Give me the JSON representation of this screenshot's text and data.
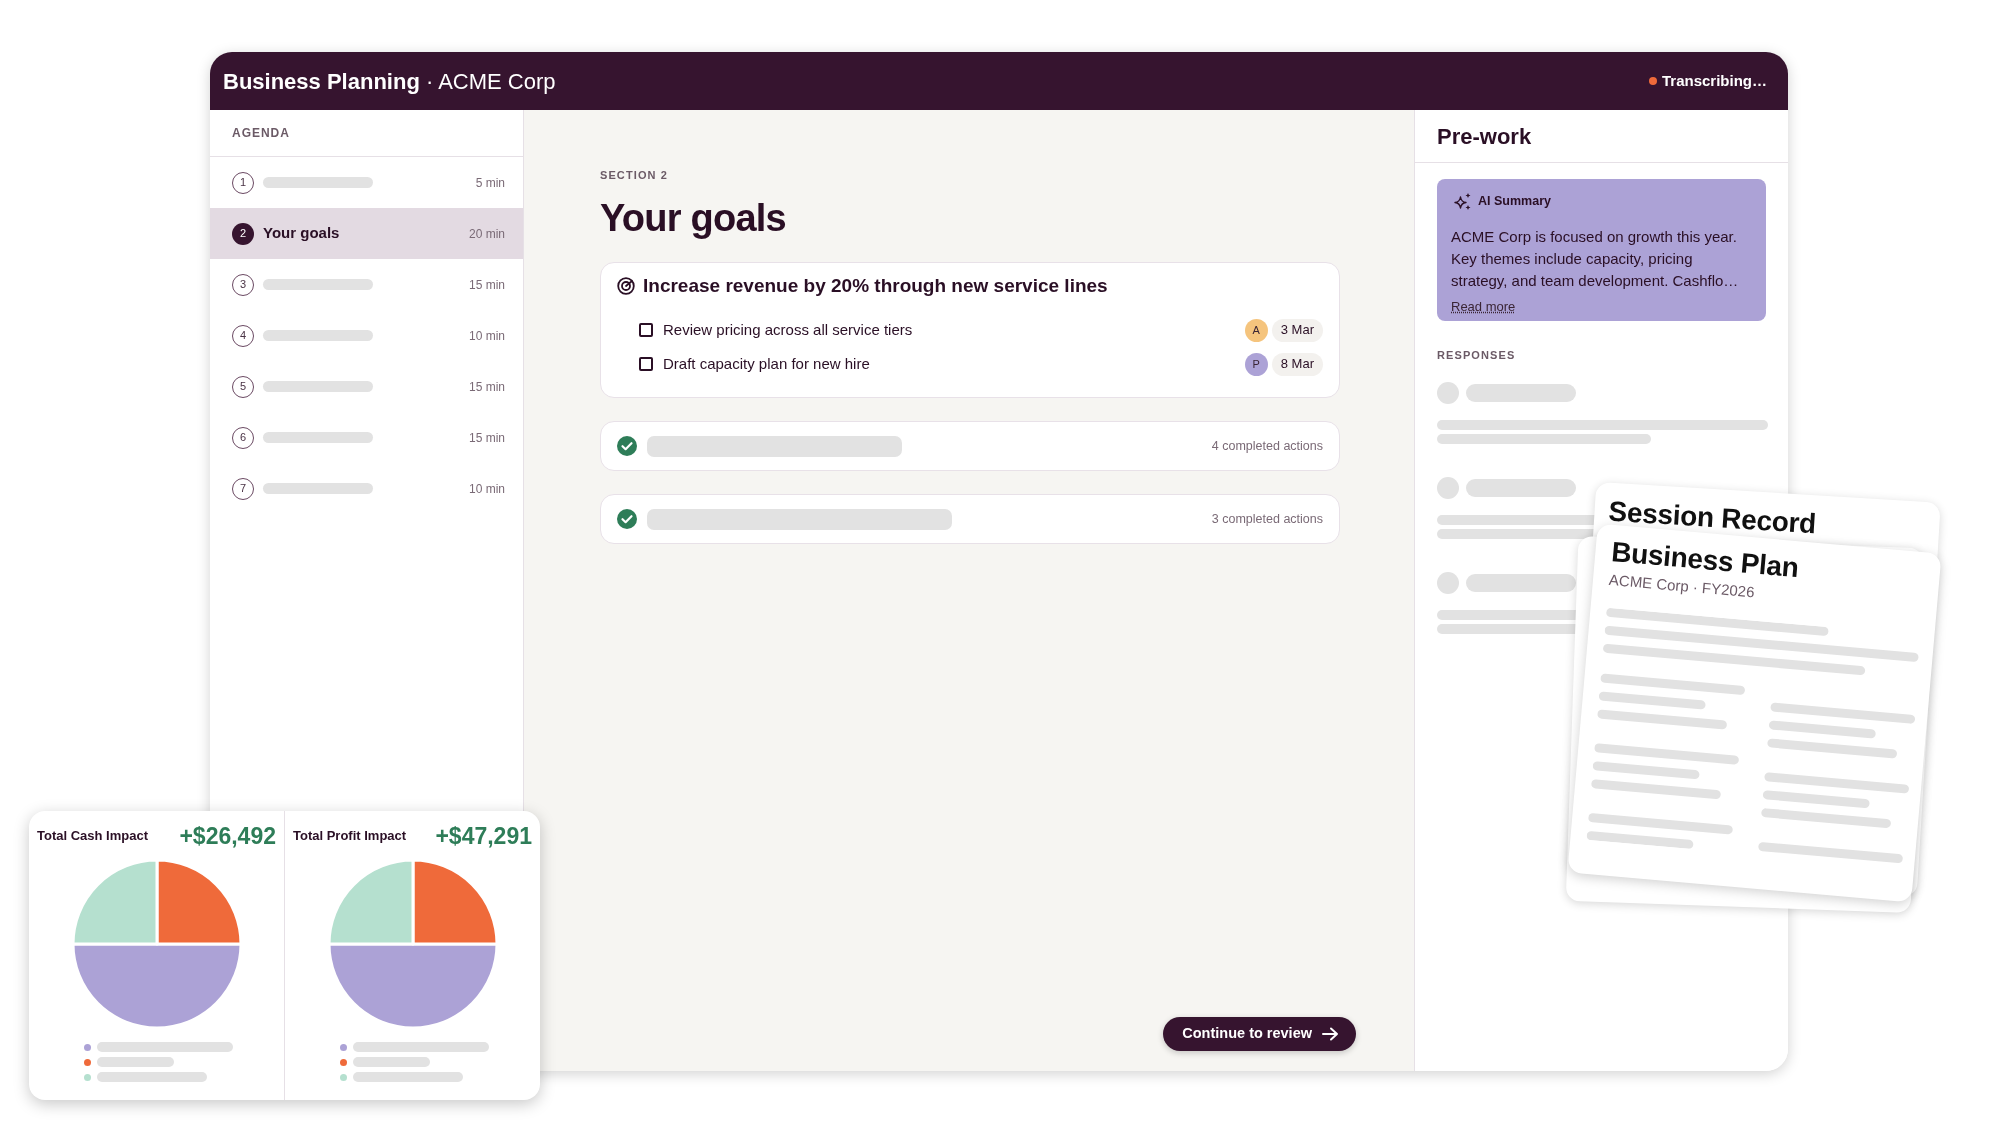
{
  "window": {
    "title": "**Business Planning** · ACME Corp",
    "status": {
      "label": "Transcribing…",
      "live": true
    }
  },
  "agenda": {
    "heading": "AGENDA",
    "items": [
      {
        "number": "1",
        "duration": "5 min",
        "selected": false
      },
      {
        "number": "2",
        "title": "Your goals",
        "duration": "20 min",
        "selected": true
      },
      {
        "number": "3",
        "duration": "15 min",
        "selected": false
      },
      {
        "number": "4",
        "duration": "10 min",
        "selected": false
      },
      {
        "number": "5",
        "duration": "15 min",
        "selected": false
      },
      {
        "number": "6",
        "duration": "15 min",
        "selected": false
      },
      {
        "number": "7",
        "duration": "10 min",
        "selected": false
      }
    ]
  },
  "section": {
    "eyebrow": "SECTION 2",
    "title": "Your goals",
    "goals": [
      {
        "expanded": true,
        "completed": false,
        "title": "Increase revenue by 20% through new service lines",
        "actions": [
          {
            "label": "Review pricing across all service tiers",
            "checked": false,
            "assignee": {
              "initial": "A",
              "color": "#f5c47d"
            },
            "due": "3 Mar"
          },
          {
            "label": "Draft capacity plan for new hire",
            "checked": false,
            "assignee": {
              "initial": "P",
              "color": "#aca2d6"
            },
            "due": "8 Mar"
          }
        ]
      },
      {
        "expanded": false,
        "completed": true,
        "summary": "4 completed actions"
      },
      {
        "expanded": false,
        "completed": true,
        "summary": "3 completed actions"
      }
    ],
    "continue_button": "Continue to review"
  },
  "prework": {
    "title": "Pre-work",
    "ai_summary": {
      "label": "AI Summary",
      "text": "ACME Corp is focused on growth this year. Key themes include capacity, pricing strategy, and team development. Cashflo…",
      "link": "Read more"
    },
    "responses_heading": "RESPONSES"
  },
  "documents": [
    {
      "title": "Session Record"
    },
    {
      "title": "Business Plan",
      "subtitle": "ACME Corp · FY2026"
    }
  ],
  "impact_charts": [
    {
      "title": "Total Cash Impact",
      "value": "+$26,492",
      "chart_data": {
        "type": "pie",
        "values": [
          50,
          25,
          25
        ]
      },
      "legend": [
        {
          "color": "#aca2d6"
        },
        {
          "color": "#ef6a3a"
        },
        {
          "color": "#b5e0cf"
        }
      ]
    },
    {
      "title": "Total Profit Impact",
      "value": "+$47,291",
      "chart_data": {
        "type": "pie",
        "values": [
          50,
          25,
          25
        ]
      },
      "legend": [
        {
          "color": "#aca2d6"
        },
        {
          "color": "#ef6a3a"
        },
        {
          "color": "#b5e0cf"
        }
      ]
    }
  ]
}
